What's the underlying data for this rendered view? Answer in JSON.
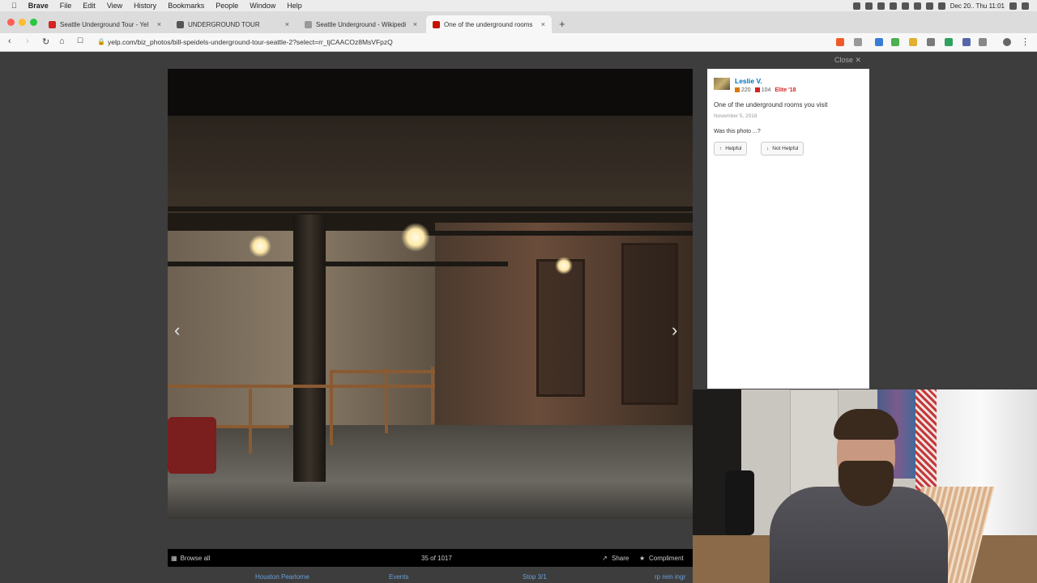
{
  "menubar": {
    "app": "Brave",
    "items": [
      "File",
      "Edit",
      "View",
      "History",
      "Bookmarks",
      "People",
      "Window",
      "Help"
    ],
    "clock": "Dec 20.. Thu  11:01"
  },
  "tabs": [
    {
      "title": "Seattle Underground Tour - Yel",
      "close": "×"
    },
    {
      "title": "UNDERGROUND TOUR",
      "close": "×"
    },
    {
      "title": "Seattle Underground - Wikipedi",
      "close": "×"
    },
    {
      "title": "One of the underground rooms",
      "close": "×"
    }
  ],
  "newtab": "+",
  "address": {
    "url": "yelp.com/biz_photos/bill-speidels-underground-tour-seattle-2?select=rr_tjCAACOz8MsVFpzQ"
  },
  "viewer": {
    "close": "Close",
    "prev": "‹",
    "next": "›",
    "browse_all": "Browse all",
    "counter": "35 of 1017",
    "share": "Share",
    "compliment": "Compliment",
    "below_links": [
      "Houston Pearlorne",
      "Events",
      "Stop 3/1",
      "rp rein ingr"
    ]
  },
  "photo_info": {
    "user": "Leslie V.",
    "friends": "220",
    "reviews": "104",
    "elite": "Elite '18",
    "caption": "One of the underground rooms you visit",
    "date": "November 5, 2018",
    "question": "Was this photo ...?",
    "helpful": "Helpful",
    "not_helpful": "Not Helpful"
  },
  "colors": {
    "accent": "#0073bb",
    "elite": "#d32323",
    "brand": "#c41200"
  }
}
